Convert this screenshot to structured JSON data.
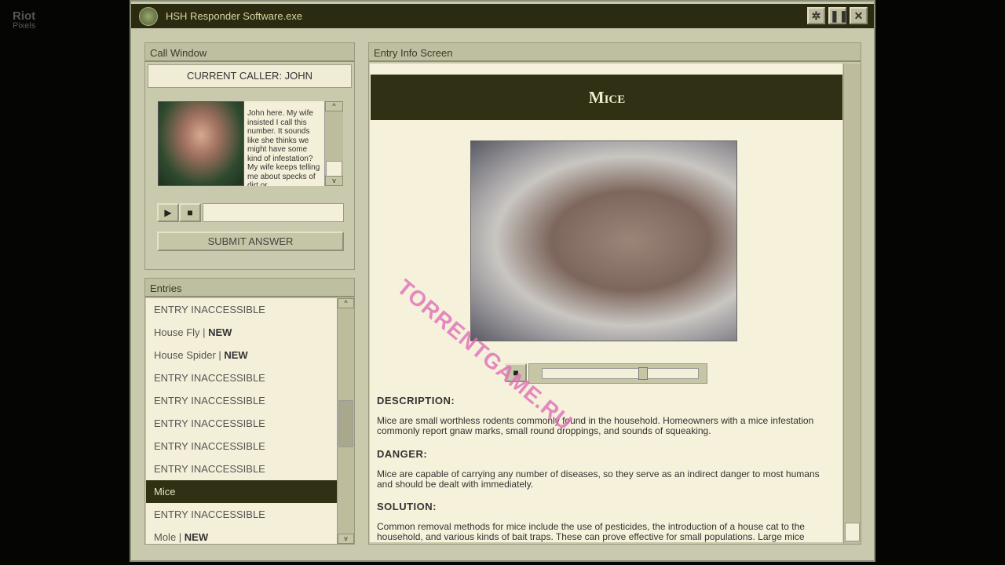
{
  "watermarks": {
    "site": "Riot",
    "site_sub": "Pixels",
    "overlay": "TORRENTGAME.RU"
  },
  "window": {
    "title": "HSH Responder Software.exe",
    "buttons": [
      "settings",
      "pause",
      "close"
    ]
  },
  "call_window": {
    "title": "Call Window",
    "caller": "CURRENT CALLER: JOHN",
    "message": "John here. My wife insisted I call this number. It sounds like she thinks we might have some kind of infestation? My wife keeps telling me about specks of dirt or",
    "submit": "SUBMIT ANSWER"
  },
  "entries": {
    "title": "Entries",
    "items": [
      {
        "label": "ENTRY INACCESSIBLE",
        "tag": ""
      },
      {
        "label": "House Fly | ",
        "tag": "NEW"
      },
      {
        "label": "House Spider | ",
        "tag": "NEW"
      },
      {
        "label": "ENTRY INACCESSIBLE",
        "tag": ""
      },
      {
        "label": "ENTRY INACCESSIBLE",
        "tag": ""
      },
      {
        "label": "ENTRY INACCESSIBLE",
        "tag": ""
      },
      {
        "label": "ENTRY INACCESSIBLE",
        "tag": ""
      },
      {
        "label": "ENTRY INACCESSIBLE",
        "tag": ""
      },
      {
        "label": "Mice",
        "tag": ""
      },
      {
        "label": "ENTRY INACCESSIBLE",
        "tag": ""
      },
      {
        "label": "Mole | ",
        "tag": "NEW"
      }
    ],
    "selected": 8
  },
  "entry_info": {
    "title": "Entry Info Screen",
    "name": "Mice",
    "audio_progress": 0.65,
    "description_label": "DESCRIPTION:",
    "description": "Mice are small worthless rodents commonly found in the household. Homeowners with a mice infestation commonly report gnaw marks, small round droppings, and sounds of squeaking.",
    "danger_label": "DANGER:",
    "danger": "Mice are capable of carrying any number of diseases, so they serve as an indirect danger to most humans and should be dealt with immediately.",
    "solution_label": "SOLUTION:",
    "solution": "Common removal methods for mice include the use of pesticides, the introduction of a house cat to the household, and various kinds of bait traps. These can prove effective for small populations. Large mice"
  }
}
